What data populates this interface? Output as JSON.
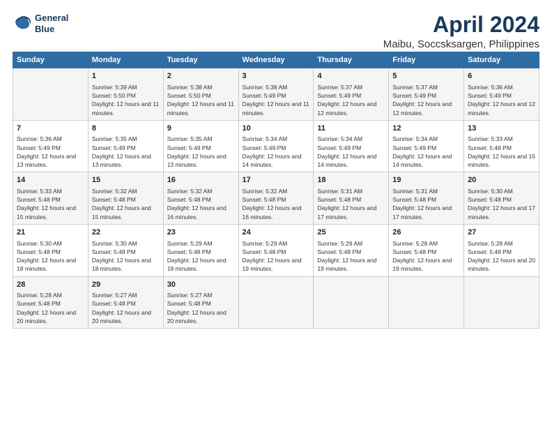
{
  "logo": {
    "line1": "General",
    "line2": "Blue"
  },
  "title": "April 2024",
  "subtitle": "Maibu, Soccsksargen, Philippines",
  "days_header": [
    "Sunday",
    "Monday",
    "Tuesday",
    "Wednesday",
    "Thursday",
    "Friday",
    "Saturday"
  ],
  "weeks": [
    [
      {
        "day": "",
        "sunrise": "",
        "sunset": "",
        "daylight": ""
      },
      {
        "day": "1",
        "sunrise": "Sunrise: 5:39 AM",
        "sunset": "Sunset: 5:50 PM",
        "daylight": "Daylight: 12 hours and 11 minutes."
      },
      {
        "day": "2",
        "sunrise": "Sunrise: 5:38 AM",
        "sunset": "Sunset: 5:50 PM",
        "daylight": "Daylight: 12 hours and 11 minutes."
      },
      {
        "day": "3",
        "sunrise": "Sunrise: 5:38 AM",
        "sunset": "Sunset: 5:49 PM",
        "daylight": "Daylight: 12 hours and 11 minutes."
      },
      {
        "day": "4",
        "sunrise": "Sunrise: 5:37 AM",
        "sunset": "Sunset: 5:49 PM",
        "daylight": "Daylight: 12 hours and 12 minutes."
      },
      {
        "day": "5",
        "sunrise": "Sunrise: 5:37 AM",
        "sunset": "Sunset: 5:49 PM",
        "daylight": "Daylight: 12 hours and 12 minutes."
      },
      {
        "day": "6",
        "sunrise": "Sunrise: 5:36 AM",
        "sunset": "Sunset: 5:49 PM",
        "daylight": "Daylight: 12 hours and 12 minutes."
      }
    ],
    [
      {
        "day": "7",
        "sunrise": "Sunrise: 5:36 AM",
        "sunset": "Sunset: 5:49 PM",
        "daylight": "Daylight: 12 hours and 13 minutes."
      },
      {
        "day": "8",
        "sunrise": "Sunrise: 5:35 AM",
        "sunset": "Sunset: 5:49 PM",
        "daylight": "Daylight: 12 hours and 13 minutes."
      },
      {
        "day": "9",
        "sunrise": "Sunrise: 5:35 AM",
        "sunset": "Sunset: 5:49 PM",
        "daylight": "Daylight: 12 hours and 13 minutes."
      },
      {
        "day": "10",
        "sunrise": "Sunrise: 5:34 AM",
        "sunset": "Sunset: 5:49 PM",
        "daylight": "Daylight: 12 hours and 14 minutes."
      },
      {
        "day": "11",
        "sunrise": "Sunrise: 5:34 AM",
        "sunset": "Sunset: 5:49 PM",
        "daylight": "Daylight: 12 hours and 14 minutes."
      },
      {
        "day": "12",
        "sunrise": "Sunrise: 5:34 AM",
        "sunset": "Sunset: 5:49 PM",
        "daylight": "Daylight: 12 hours and 14 minutes."
      },
      {
        "day": "13",
        "sunrise": "Sunrise: 5:33 AM",
        "sunset": "Sunset: 5:48 PM",
        "daylight": "Daylight: 12 hours and 15 minutes."
      }
    ],
    [
      {
        "day": "14",
        "sunrise": "Sunrise: 5:33 AM",
        "sunset": "Sunset: 5:48 PM",
        "daylight": "Daylight: 12 hours and 15 minutes."
      },
      {
        "day": "15",
        "sunrise": "Sunrise: 5:32 AM",
        "sunset": "Sunset: 5:48 PM",
        "daylight": "Daylight: 12 hours and 15 minutes."
      },
      {
        "day": "16",
        "sunrise": "Sunrise: 5:32 AM",
        "sunset": "Sunset: 5:48 PM",
        "daylight": "Daylight: 12 hours and 16 minutes."
      },
      {
        "day": "17",
        "sunrise": "Sunrise: 5:32 AM",
        "sunset": "Sunset: 5:48 PM",
        "daylight": "Daylight: 12 hours and 16 minutes."
      },
      {
        "day": "18",
        "sunrise": "Sunrise: 5:31 AM",
        "sunset": "Sunset: 5:48 PM",
        "daylight": "Daylight: 12 hours and 17 minutes."
      },
      {
        "day": "19",
        "sunrise": "Sunrise: 5:31 AM",
        "sunset": "Sunset: 5:48 PM",
        "daylight": "Daylight: 12 hours and 17 minutes."
      },
      {
        "day": "20",
        "sunrise": "Sunrise: 5:30 AM",
        "sunset": "Sunset: 5:48 PM",
        "daylight": "Daylight: 12 hours and 17 minutes."
      }
    ],
    [
      {
        "day": "21",
        "sunrise": "Sunrise: 5:30 AM",
        "sunset": "Sunset: 5:48 PM",
        "daylight": "Daylight: 12 hours and 18 minutes."
      },
      {
        "day": "22",
        "sunrise": "Sunrise: 5:30 AM",
        "sunset": "Sunset: 5:48 PM",
        "daylight": "Daylight: 12 hours and 18 minutes."
      },
      {
        "day": "23",
        "sunrise": "Sunrise: 5:29 AM",
        "sunset": "Sunset: 5:48 PM",
        "daylight": "Daylight: 12 hours and 19 minutes."
      },
      {
        "day": "24",
        "sunrise": "Sunrise: 5:29 AM",
        "sunset": "Sunset: 5:48 PM",
        "daylight": "Daylight: 12 hours and 19 minutes."
      },
      {
        "day": "25",
        "sunrise": "Sunrise: 5:29 AM",
        "sunset": "Sunset: 5:48 PM",
        "daylight": "Daylight: 12 hours and 19 minutes."
      },
      {
        "day": "26",
        "sunrise": "Sunrise: 5:28 AM",
        "sunset": "Sunset: 5:48 PM",
        "daylight": "Daylight: 12 hours and 19 minutes."
      },
      {
        "day": "27",
        "sunrise": "Sunrise: 5:28 AM",
        "sunset": "Sunset: 5:48 PM",
        "daylight": "Daylight: 12 hours and 20 minutes."
      }
    ],
    [
      {
        "day": "28",
        "sunrise": "Sunrise: 5:28 AM",
        "sunset": "Sunset: 5:48 PM",
        "daylight": "Daylight: 12 hours and 20 minutes."
      },
      {
        "day": "29",
        "sunrise": "Sunrise: 5:27 AM",
        "sunset": "Sunset: 5:48 PM",
        "daylight": "Daylight: 12 hours and 20 minutes."
      },
      {
        "day": "30",
        "sunrise": "Sunrise: 5:27 AM",
        "sunset": "Sunset: 5:48 PM",
        "daylight": "Daylight: 12 hours and 20 minutes."
      },
      {
        "day": "",
        "sunrise": "",
        "sunset": "",
        "daylight": ""
      },
      {
        "day": "",
        "sunrise": "",
        "sunset": "",
        "daylight": ""
      },
      {
        "day": "",
        "sunrise": "",
        "sunset": "",
        "daylight": ""
      },
      {
        "day": "",
        "sunrise": "",
        "sunset": "",
        "daylight": ""
      }
    ]
  ]
}
